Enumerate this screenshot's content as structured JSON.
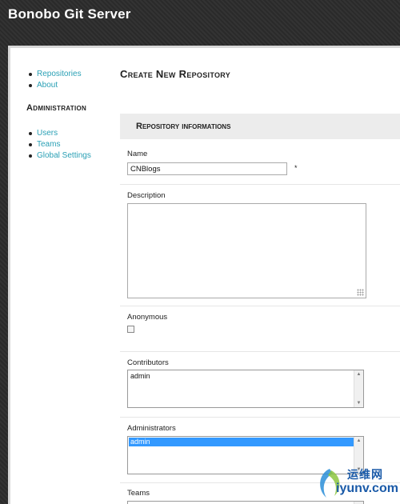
{
  "app": {
    "title": "Bonobo Git Server"
  },
  "sidebar": {
    "top_items": [
      {
        "label": "Repositories"
      },
      {
        "label": "About"
      }
    ],
    "admin_heading": "Administration",
    "admin_items": [
      {
        "label": "Users"
      },
      {
        "label": "Teams"
      },
      {
        "label": "Global Settings"
      }
    ]
  },
  "main": {
    "page_title": "Create New Repository",
    "section_title": "Repository informations",
    "name": {
      "label": "Name",
      "value": "CNBlogs",
      "required_mark": "*"
    },
    "description": {
      "label": "Description",
      "value": ""
    },
    "anonymous": {
      "label": "Anonymous",
      "checked": false
    },
    "contributors": {
      "label": "Contributors",
      "options": [
        "admin"
      ],
      "selected": []
    },
    "administrators": {
      "label": "Administrators",
      "options": [
        "admin"
      ],
      "selected": [
        "admin"
      ]
    },
    "teams": {
      "label": "Teams"
    }
  },
  "watermark": {
    "cn": "运维网",
    "url": "iyunv.com"
  },
  "colors": {
    "link": "#2aa0b5",
    "selection": "#3399ff",
    "header_bg": "#2e2e2e",
    "section_bg": "#ececec"
  }
}
